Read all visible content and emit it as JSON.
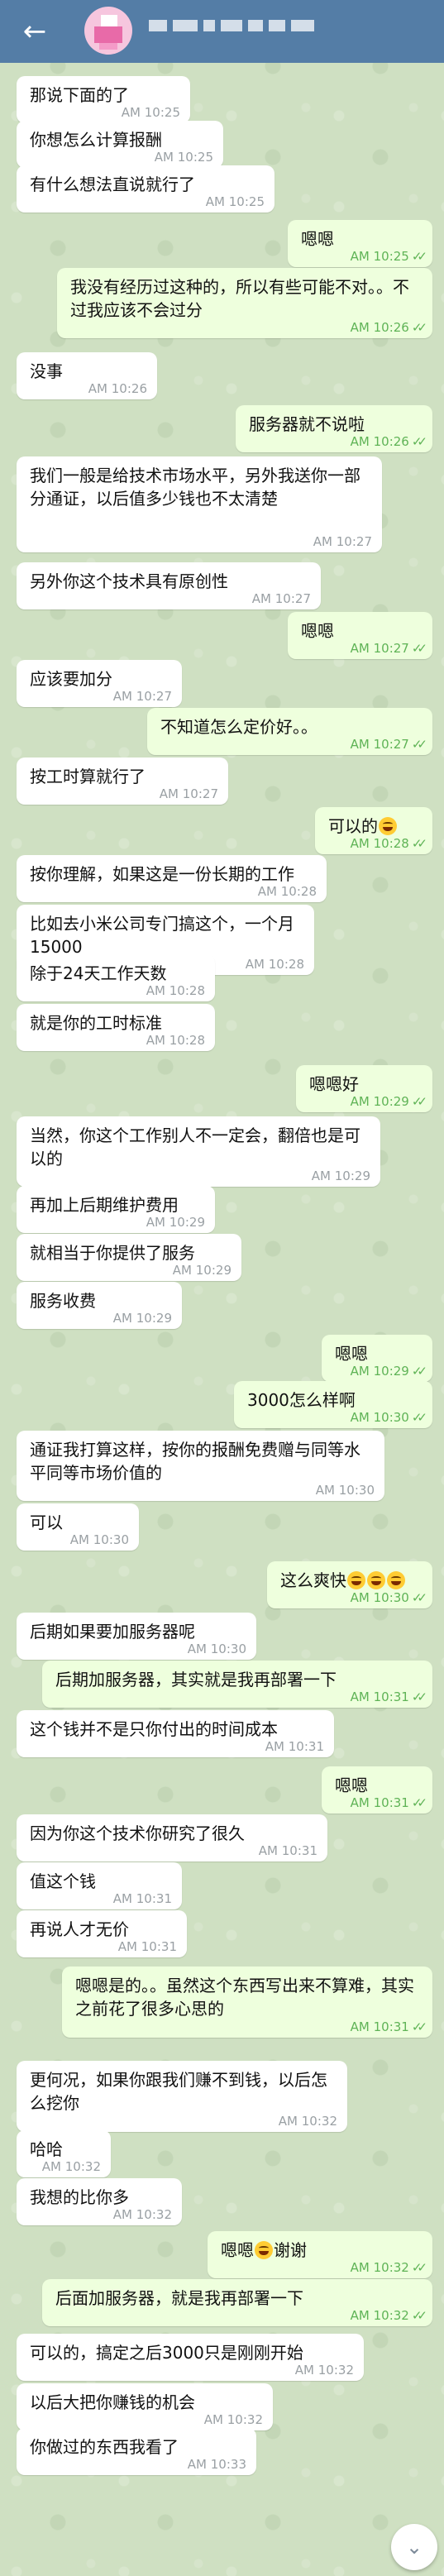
{
  "header": {
    "back_icon": "arrow-left-icon",
    "bar_color": "#547da6"
  },
  "colors": {
    "incoming": "#ffffff",
    "outgoing": "#eeffdd",
    "time_out": "#5fb356"
  },
  "messages": [
    {
      "dir": "in",
      "text": "那说下面的了",
      "time": "AM 10:25"
    },
    {
      "dir": "in",
      "text": "你想怎么计算报酬",
      "time": "AM 10:25"
    },
    {
      "dir": "in",
      "text": "有什么想法直说就行了",
      "time": "AM 10:25"
    },
    {
      "dir": "out",
      "text": "嗯嗯",
      "time": "AM 10:25"
    },
    {
      "dir": "out",
      "text": "我没有经历过这种的，所以有些可能不对。。不过我应该不会过分",
      "time": "AM 10:26"
    },
    {
      "dir": "in",
      "text": "没事",
      "time": "AM 10:26"
    },
    {
      "dir": "out",
      "text": "服务器就不说啦",
      "time": "AM 10:26"
    },
    {
      "dir": "in",
      "text": "我们一般是给技术市场水平，另外我送你一部分通证，以后值多少钱也不太清楚",
      "time": "AM 10:27"
    },
    {
      "dir": "in",
      "text": "另外你这个技术具有原创性",
      "time": "AM 10:27"
    },
    {
      "dir": "out",
      "text": "嗯嗯",
      "time": "AM 10:27"
    },
    {
      "dir": "in",
      "text": "应该要加分",
      "time": "AM 10:27"
    },
    {
      "dir": "out",
      "text": "不知道怎么定价好。。",
      "time": "AM 10:27"
    },
    {
      "dir": "in",
      "text": "按工时算就行了",
      "time": "AM 10:27"
    },
    {
      "dir": "out",
      "text": "可以的",
      "emoji": 1,
      "time": "AM 10:28"
    },
    {
      "dir": "in",
      "text": "按你理解，如果这是一份长期的工作",
      "time": "AM 10:28"
    },
    {
      "dir": "in",
      "text": "比如去小米公司专门搞这个，一个月15000",
      "time": "AM 10:28"
    },
    {
      "dir": "in",
      "text": "除于24天工作天数",
      "time": "AM 10:28"
    },
    {
      "dir": "in",
      "text": "就是你的工时标准",
      "time": "AM 10:28"
    },
    {
      "dir": "out",
      "text": "嗯嗯好",
      "time": "AM 10:29"
    },
    {
      "dir": "in",
      "text": "当然，你这个工作别人不一定会，翻倍也是可以的",
      "time": "AM 10:29"
    },
    {
      "dir": "in",
      "text": "再加上后期维护费用",
      "time": "AM 10:29"
    },
    {
      "dir": "in",
      "text": "就相当于你提供了服务",
      "time": "AM 10:29"
    },
    {
      "dir": "in",
      "text": "服务收费",
      "time": "AM 10:29"
    },
    {
      "dir": "out",
      "text": "嗯嗯",
      "time": "AM 10:29"
    },
    {
      "dir": "out",
      "text": "3000怎么样啊",
      "time": "AM 10:30"
    },
    {
      "dir": "in",
      "text": "通证我打算这样，按你的报酬免费赠与同等水平同等市场价值的",
      "time": "AM 10:30"
    },
    {
      "dir": "in",
      "text": "可以",
      "time": "AM 10:30"
    },
    {
      "dir": "out",
      "text": "这么爽快",
      "emoji": 3,
      "time": "AM 10:30"
    },
    {
      "dir": "in",
      "text": "后期如果要加服务器呢",
      "time": "AM 10:30"
    },
    {
      "dir": "out",
      "text": "后期加服务器，其实就是我再部署一下",
      "time": "AM 10:31"
    },
    {
      "dir": "in",
      "text": "这个钱并不是只你付出的时间成本",
      "time": "AM 10:31"
    },
    {
      "dir": "out",
      "text": "嗯嗯",
      "time": "AM 10:31"
    },
    {
      "dir": "in",
      "text": "因为你这个技术你研究了很久",
      "time": "AM 10:31"
    },
    {
      "dir": "in",
      "text": "值这个钱",
      "time": "AM 10:31"
    },
    {
      "dir": "in",
      "text": "再说人才无价",
      "time": "AM 10:31"
    },
    {
      "dir": "out",
      "text": "嗯嗯是的。。虽然这个东西写出来不算难，其实之前花了很多心思的",
      "time": "AM 10:31"
    },
    {
      "dir": "in",
      "text": "更何况，如果你跟我们赚不到钱，以后怎么挖你",
      "time": "AM 10:32"
    },
    {
      "dir": "in",
      "text": "哈哈",
      "time": "AM 10:32"
    },
    {
      "dir": "in",
      "text": "我想的比你多",
      "time": "AM 10:32"
    },
    {
      "dir": "out",
      "text": "嗯嗯",
      "emoji": 1,
      "text_after": "谢谢",
      "time": "AM 10:32"
    },
    {
      "dir": "out",
      "text": "后面加服务器，就是我再部署一下",
      "time": "AM 10:32"
    },
    {
      "dir": "in",
      "text": "可以的，搞定之后3000只是刚刚开始",
      "time": "AM 10:32"
    },
    {
      "dir": "in",
      "text": "以后大把你赚钱的机会",
      "time": "AM 10:32"
    },
    {
      "dir": "in",
      "text": "你做过的东西我看了",
      "time": "AM 10:33"
    }
  ],
  "scroll_button": {
    "icon": "chevron-down-icon"
  }
}
